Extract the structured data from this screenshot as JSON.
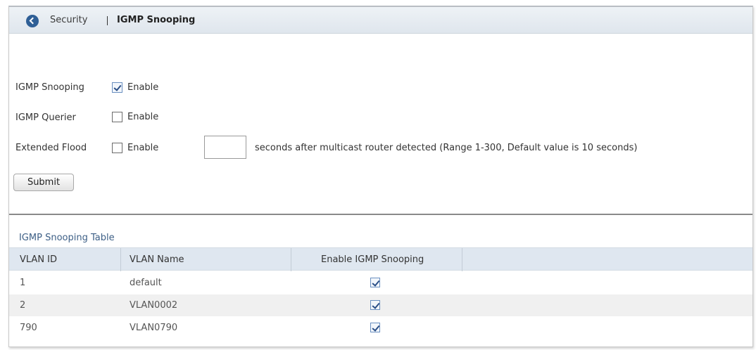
{
  "breadcrumb": {
    "parent": "Security",
    "current": "IGMP Snooping"
  },
  "settings": {
    "igmp_snooping": {
      "label": "IGMP Snooping",
      "option": "Enable",
      "checked": true
    },
    "igmp_querier": {
      "label": "IGMP Querier",
      "option": "Enable",
      "checked": false
    },
    "extended_flood": {
      "label": "Extended Flood",
      "option": "Enable",
      "checked": false,
      "value": "",
      "suffix": "seconds after multicast router detected (Range 1-300, Default value is 10 seconds)"
    }
  },
  "submit_label": "Submit",
  "table": {
    "title": "IGMP Snooping Table",
    "columns": [
      "VLAN ID",
      "VLAN Name",
      "Enable IGMP Snooping"
    ],
    "rows": [
      {
        "vlan_id": "1",
        "vlan_name": "default",
        "enabled": true
      },
      {
        "vlan_id": "2",
        "vlan_name": "VLAN0002",
        "enabled": true
      },
      {
        "vlan_id": "790",
        "vlan_name": "VLAN0790",
        "enabled": true
      }
    ]
  },
  "colors": {
    "header_bg": "#dfe6ed",
    "accent": "#2f5f96",
    "table_title": "#3d5f86",
    "table_header_bg": "#dfe7f0",
    "alt_row_bg": "#f0f0f0"
  },
  "icons": {
    "back": "chevron-left-circle-icon",
    "check": "checkmark-icon"
  }
}
